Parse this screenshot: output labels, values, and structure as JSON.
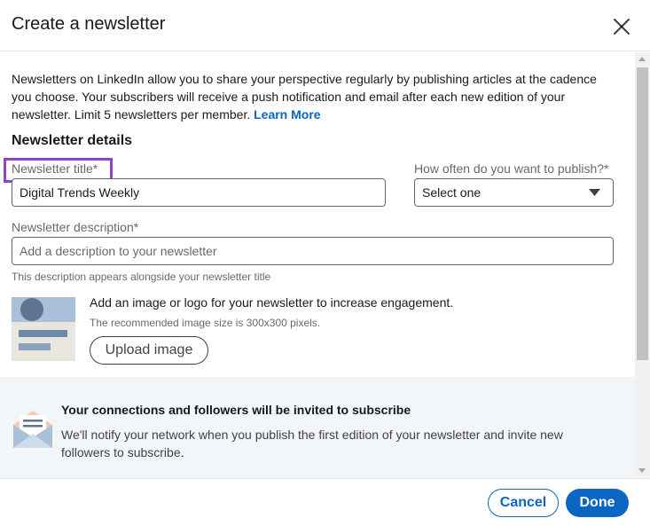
{
  "dialog": {
    "title": "Create a newsletter",
    "close_icon": "close-icon"
  },
  "intro": {
    "text": "Newsletters on LinkedIn allow you to share your perspective regularly by publishing articles at the cadence you choose. Your subscribers will receive a push notification and email after each new edition of your newsletter. Limit 5 newsletters per member. ",
    "link_label": "Learn More"
  },
  "details": {
    "section_title": "Newsletter details",
    "title_label": "Newsletter title*",
    "title_value": "Digital Trends Weekly",
    "frequency_label": "How often do you want to publish?*",
    "frequency_value": "Select one",
    "description_label": "Newsletter description*",
    "description_value": "",
    "description_placeholder": "Add a description to your newsletter",
    "description_helper": "This description appears alongside your newsletter title"
  },
  "image": {
    "prompt": "Add an image or logo for your newsletter to increase engagement.",
    "size_hint": "The recommended image size is 300x300 pixels.",
    "upload_label": "Upload image",
    "icon": "image-placeholder-icon"
  },
  "notice": {
    "title": "Your connections and followers will be invited to subscribe",
    "body": "We'll notify your network when you publish the first edition of your newsletter and invite new followers to subscribe.",
    "icon": "envelope-icon"
  },
  "footer": {
    "cancel_label": "Cancel",
    "done_label": "Done"
  },
  "colors": {
    "accent": "#0a66c2",
    "highlight": "#8e44c9",
    "notice_bg": "#f3f6f8"
  }
}
